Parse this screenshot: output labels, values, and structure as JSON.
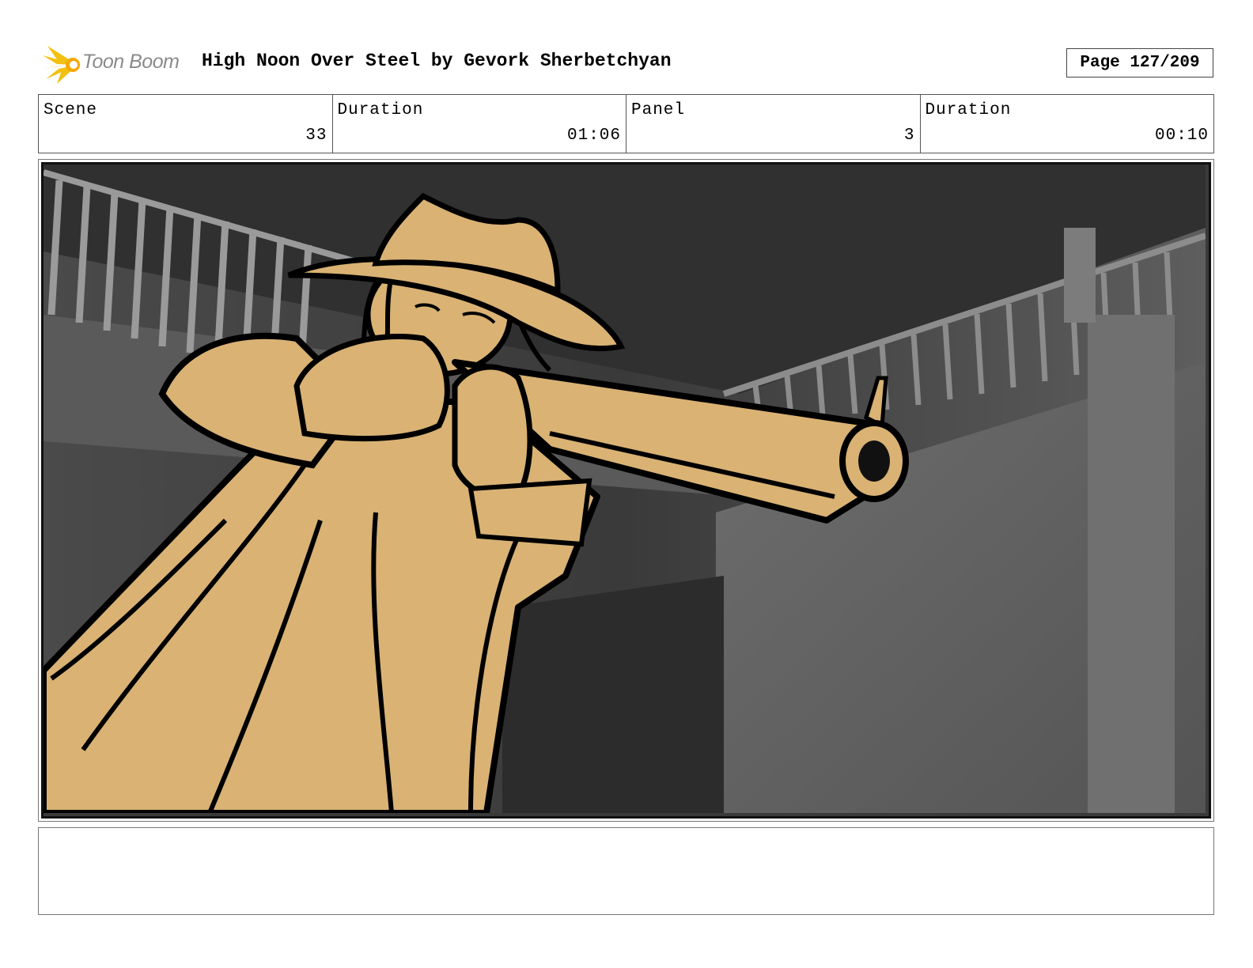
{
  "header": {
    "logo_text": "Toon Boom",
    "title": "High Noon Over Steel by Gevork Sherbetchyan",
    "page": "Page 127/209"
  },
  "info": {
    "scene_label": "Scene",
    "scene_value": "33",
    "scene_duration_label": "Duration",
    "scene_duration_value": "01:06",
    "panel_label": "Panel",
    "panel_value": "3",
    "panel_duration_label": "Duration",
    "panel_duration_value": "00:10"
  },
  "panel": {
    "subject": "gunslinger",
    "colors": {
      "figure": "#d9b274",
      "background_dark": "#3a3a3a",
      "background_light": "#6c6c6c",
      "frame": "#2e7d32"
    }
  },
  "notes": {
    "text": ""
  }
}
